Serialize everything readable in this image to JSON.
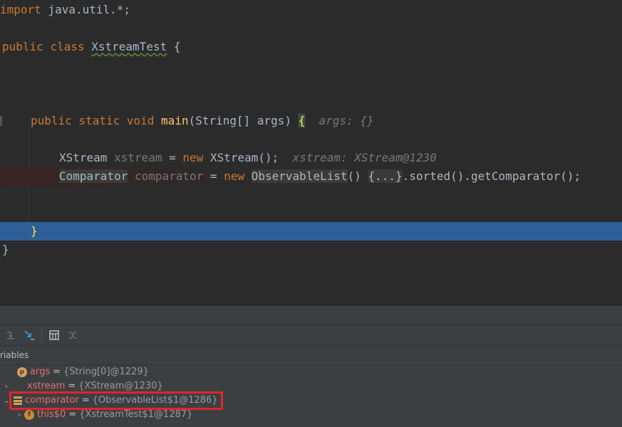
{
  "code": {
    "import_kw": "import",
    "import_pkg": " java.util.*;",
    "class_public": "public",
    "class_kw": "class",
    "class_name": "XstreamTest",
    "class_brace": " {",
    "main_public": "public",
    "main_static": "static",
    "main_void": "void",
    "main_name": "main",
    "main_params": "(String[] args) ",
    "main_brace": "{",
    "main_hint": "args: {}",
    "line1_type": "XStream",
    "line1_var": "xstream",
    "line1_eq": " = ",
    "line1_new": "new",
    "line1_ctor": " XStream();",
    "line1_hint": "xstream: XStream@1230",
    "line2_type": "Comparator",
    "line2_var": "comparator",
    "line2_eq": " = ",
    "line2_new": "new",
    "line2_ctor": "ObservableList",
    "line2_paren": "()",
    "line2_fold": "{...}",
    "line2_rest": ".sorted().getComparator();",
    "close_method": "}",
    "close_class": "}"
  },
  "debugger": {
    "section_title": "riables",
    "variables": [
      {
        "name": "args",
        "value": "{String[0]@1229}",
        "badge": "p",
        "expandable": false
      },
      {
        "name": "xstream",
        "value": "{XStream@1230}",
        "badge": "none",
        "expandable": true
      },
      {
        "name": "comparator",
        "value": "{ObservableList$1@1286}",
        "badge": "stack",
        "expandable": true,
        "expanded": true
      },
      {
        "name": "this$0",
        "value": "{XstreamTest$1@1287}",
        "badge": "f",
        "expandable": true
      }
    ],
    "badge_p": "p",
    "badge_f": "f"
  },
  "colors": {
    "editor_bg": "#2b2b2b",
    "current_line": "#2d5e98",
    "keyword": "#cc7832",
    "method": "#ffc66d",
    "var_name": "#e36f6f",
    "selection_box": "#e0252b"
  }
}
